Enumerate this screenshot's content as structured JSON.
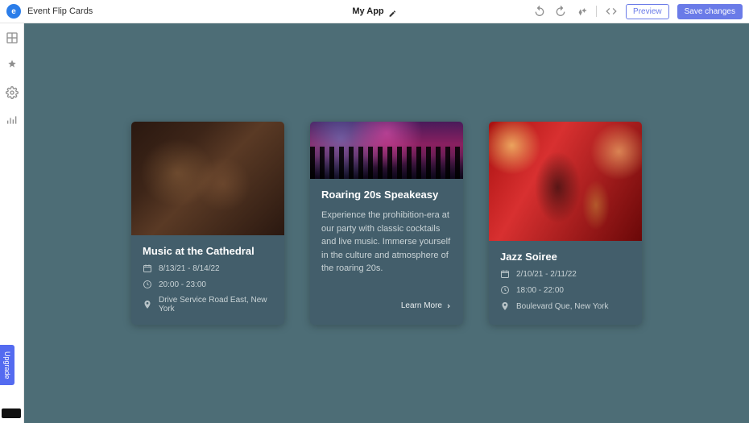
{
  "toolbar": {
    "page_name": "Event Flip Cards",
    "app_name": "My App",
    "preview_label": "Preview",
    "save_label": "Save changes"
  },
  "upgrade_label": "Upgrade",
  "cards": [
    {
      "title": "Music at the Cathedral",
      "date": "8/13/21 - 8/14/22",
      "time": "20:00 - 23:00",
      "location": "Drive Service Road East, New York"
    },
    {
      "title": "Roaring 20s Speakeasy",
      "description": "Experience the prohibition-era at our party with classic cocktails and live music. Immerse yourself in the culture and atmosphere of the roaring 20s.",
      "learn_more": "Learn More"
    },
    {
      "title": "Jazz Soiree",
      "date": "2/10/21 - 2/11/22",
      "time": "18:00 - 22:00",
      "location": "Boulevard Que, New York"
    }
  ]
}
